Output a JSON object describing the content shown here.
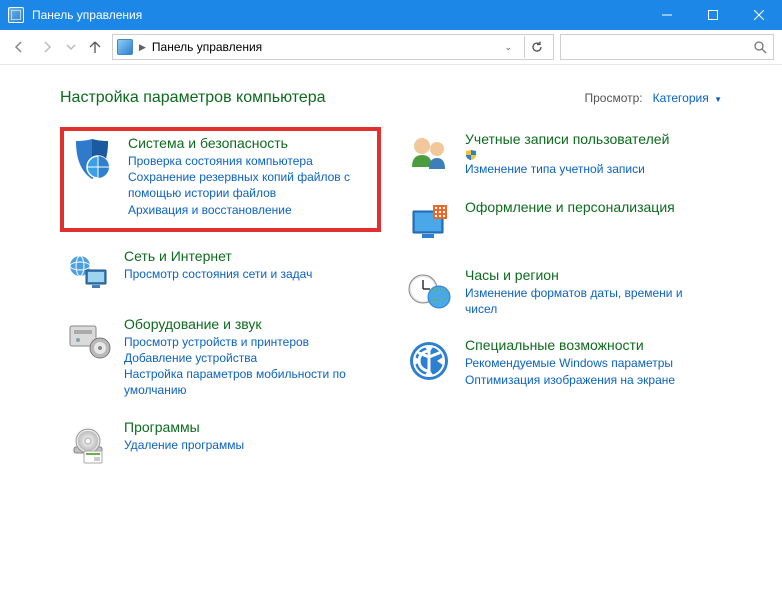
{
  "titlebar": {
    "title": "Панель управления"
  },
  "address": {
    "crumb": "Панель управления"
  },
  "header": {
    "title": "Настройка параметров компьютера",
    "viewByLabel": "Просмотр:",
    "viewByValue": "Категория"
  },
  "categories": {
    "systemSecurity": {
      "title": "Система и безопасность",
      "links": [
        "Проверка состояния компьютера",
        "Сохранение резервных копий файлов с помощью истории файлов",
        "Архивация и восстановление"
      ]
    },
    "network": {
      "title": "Сеть и Интернет",
      "links": [
        "Просмотр состояния сети и задач"
      ]
    },
    "hardware": {
      "title": "Оборудование и звук",
      "links": [
        "Просмотр устройств и принтеров",
        "Добавление устройства",
        "Настройка параметров мобильности по умолчанию"
      ]
    },
    "programs": {
      "title": "Программы",
      "links": [
        "Удаление программы"
      ]
    },
    "accounts": {
      "title": "Учетные записи пользователей",
      "links": [
        "Изменение типа учетной записи"
      ]
    },
    "appearance": {
      "title": "Оформление и персонализация",
      "links": []
    },
    "clock": {
      "title": "Часы и регион",
      "links": [
        "Изменение форматов даты, времени и чисел"
      ]
    },
    "ease": {
      "title": "Специальные возможности",
      "links": [
        "Рекомендуемые Windows параметры",
        "Оптимизация изображения на экране"
      ]
    }
  }
}
